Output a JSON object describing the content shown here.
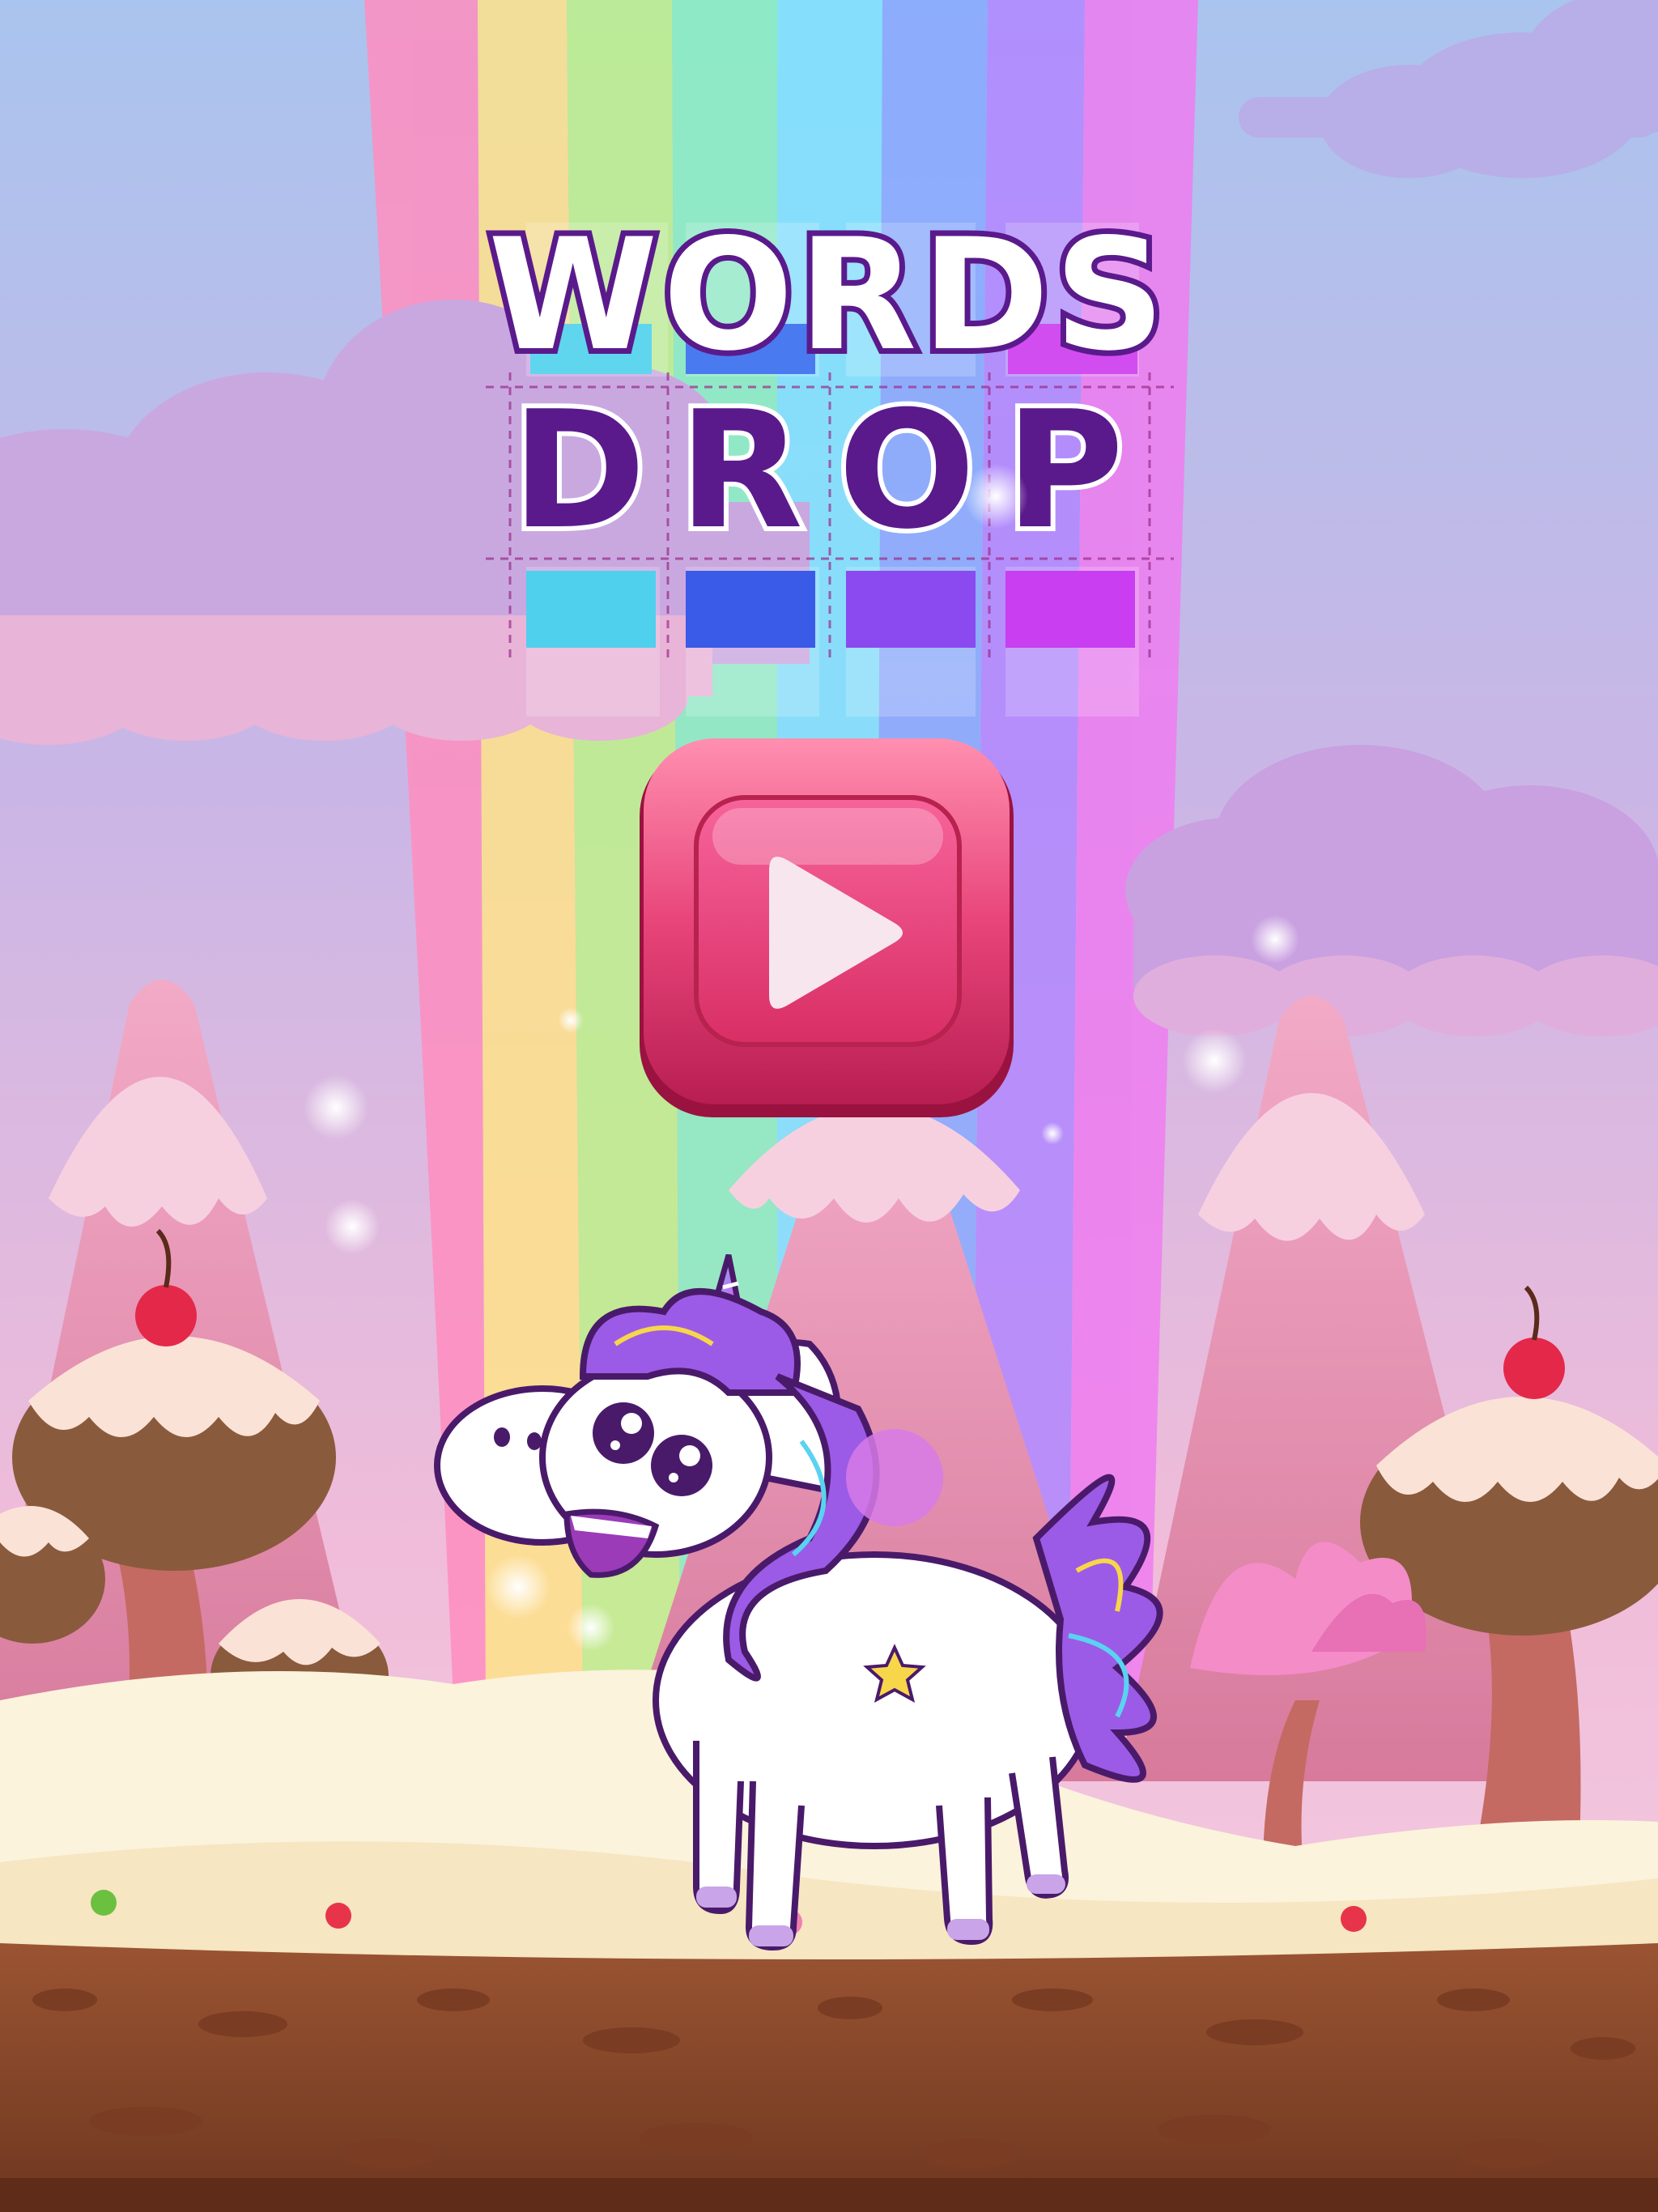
{
  "game": {
    "title_line1": "WORDS",
    "title_line2_letters": [
      "D",
      "R",
      "O",
      "P"
    ]
  },
  "play_button": {
    "icon": "play-icon"
  },
  "colors": {
    "sky_top": "#a9c4ee",
    "sky_bottom": "#f3b8d8",
    "title_purple": "#5a1a8c",
    "button_pink": "#e8457a",
    "ground_brown": "#8a4a2a",
    "cream": "#fbf3dc",
    "unicorn_mane": "#9b5be6"
  }
}
